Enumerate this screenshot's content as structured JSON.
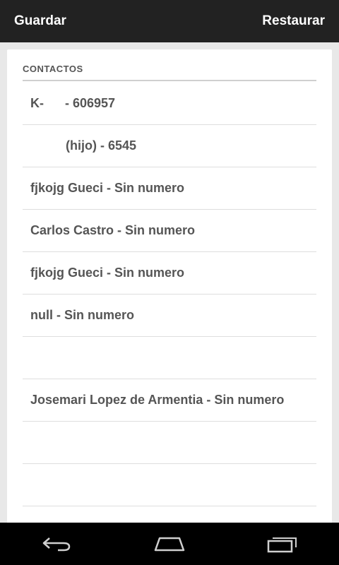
{
  "action_bar": {
    "save_label": "Guardar",
    "restore_label": "Restaurar"
  },
  "section": {
    "header": "CONTACTOS"
  },
  "contacts": [
    {
      "label": "K-      - 606957"
    },
    {
      "label": "          (hijo) - 6545"
    },
    {
      "label": "fjkojg Gueci - Sin numero"
    },
    {
      "label": "Carlos Castro - Sin numero"
    },
    {
      "label": "fjkojg Gueci - Sin numero"
    },
    {
      "label": "null - Sin numero"
    },
    {
      "label": ""
    },
    {
      "label": "Josemari Lopez de Armentia - Sin numero"
    },
    {
      "label": ""
    },
    {
      "label": ""
    },
    {
      "label": ""
    }
  ],
  "nav": {
    "back_icon": "back-icon",
    "home_icon": "home-icon",
    "recents_icon": "recents-icon"
  },
  "colors": {
    "action_bar_bg": "#222222",
    "background": "#e8e8e8",
    "card_bg": "#ffffff",
    "text": "#555555",
    "nav_bg": "#000000"
  }
}
